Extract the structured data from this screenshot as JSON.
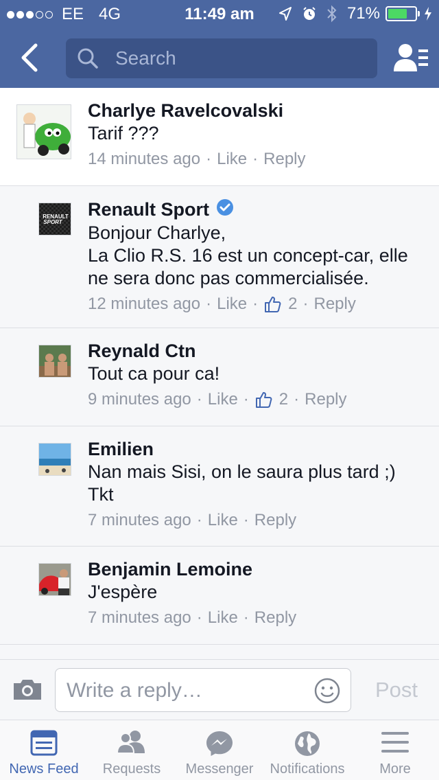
{
  "status_bar": {
    "carrier": "EE",
    "network": "4G",
    "time": "11:49 am",
    "battery": "71%",
    "battery_level": 0.71,
    "signal_bars_filled": 3,
    "signal_bars_total": 5
  },
  "nav": {
    "search_placeholder": "Search"
  },
  "post": {
    "author": "Charlye Ravelcovalski",
    "text": "Tarif ???",
    "time": "14 minutes ago",
    "like_label": "Like",
    "reply_label": "Reply"
  },
  "replies": [
    {
      "author": "Renault Sport",
      "verified": true,
      "avatar_text": [
        "RENAULT",
        "SPORT"
      ],
      "text_lines": [
        "Bonjour Charlye,",
        "La Clio R.S. 16 est un concept-car, elle ne sera donc pas commercialisée."
      ],
      "time": "12 minutes ago",
      "like_label": "Like",
      "likes": "2",
      "reply_label": "Reply"
    },
    {
      "author": "Reynald Ctn",
      "text_lines": [
        "Tout ca pour ca!"
      ],
      "time": "9 minutes ago",
      "like_label": "Like",
      "likes": "2",
      "reply_label": "Reply"
    },
    {
      "author": "Emilien",
      "text_lines": [
        "Nan mais Sisi, on le saura plus tard ;)",
        "Tkt"
      ],
      "time": "7 minutes ago",
      "like_label": "Like",
      "reply_label": "Reply"
    },
    {
      "author": "Benjamin Lemoine",
      "text_lines": [
        "J'espère"
      ],
      "time": "7 minutes ago",
      "like_label": "Like",
      "reply_label": "Reply"
    }
  ],
  "composer": {
    "placeholder": "Write a reply…",
    "post_label": "Post"
  },
  "tabs": [
    {
      "label": "News Feed",
      "icon": "news-feed-icon",
      "active": true
    },
    {
      "label": "Requests",
      "icon": "friend-requests-icon",
      "active": false
    },
    {
      "label": "Messenger",
      "icon": "messenger-icon",
      "active": false
    },
    {
      "label": "Notifications",
      "icon": "globe-icon",
      "active": false
    },
    {
      "label": "More",
      "icon": "hamburger-menu-icon",
      "active": false
    }
  ],
  "colors": {
    "brand_blue": "#4b67a1",
    "search_bg": "#3b5387",
    "link_blue": "#4267b2",
    "meta_gray": "#9197a3",
    "battery_green": "#4cd964",
    "verified_blue": "#4a90e2"
  }
}
